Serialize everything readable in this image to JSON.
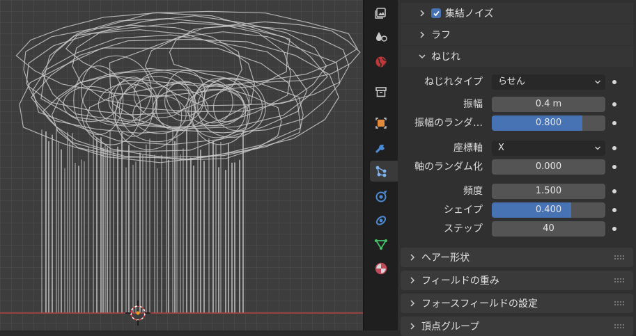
{
  "sidebar_tabs": [
    {
      "name": "render-icon"
    },
    {
      "name": "texture-icon"
    },
    {
      "name": "world-icon"
    },
    {
      "name": "collection-icon"
    },
    {
      "name": "object-icon"
    },
    {
      "name": "modifier-icon"
    },
    {
      "name": "particles-icon",
      "active": true
    },
    {
      "name": "physics-icon"
    },
    {
      "name": "constraints-icon"
    },
    {
      "name": "object-data-icon"
    },
    {
      "name": "material-icon"
    }
  ],
  "subpanels": {
    "clump_noise": {
      "label": "集結ノイズ",
      "checked": true
    },
    "roughness": {
      "label": "ラフ"
    },
    "kink": {
      "label": "ねじれ"
    }
  },
  "kink_fields": {
    "kink_type": {
      "label": "ねじれタイプ",
      "value": "らせん"
    },
    "amplitude": {
      "label": "振幅",
      "value": "0.4 m"
    },
    "amplitude_random": {
      "label": "振幅のランダ…",
      "value": "0.800",
      "fraction": 0.8
    },
    "axis": {
      "label": "座標軸",
      "value": "X"
    },
    "axis_random": {
      "label": "軸のランダム化",
      "value": "0.000"
    },
    "frequency": {
      "label": "頻度",
      "value": "1.500"
    },
    "shape": {
      "label": "シェイプ",
      "value": "0.400",
      "fraction": 0.7
    },
    "steps": {
      "label": "ステップ",
      "value": "40"
    }
  },
  "collapsed_panels": [
    {
      "label": "ヘアー形状"
    },
    {
      "label": "フィールドの重み"
    },
    {
      "label": "フォースフィールドの設定"
    },
    {
      "label": "頂点グループ"
    }
  ],
  "colors": {
    "accent": "#4772b3",
    "field": "#545454",
    "dropdown": "#282828",
    "panel_bg": "#303030",
    "viewport_bg": "#3d3d3d",
    "hair": "#c8c8c8",
    "floor_axis": "#b34040"
  }
}
